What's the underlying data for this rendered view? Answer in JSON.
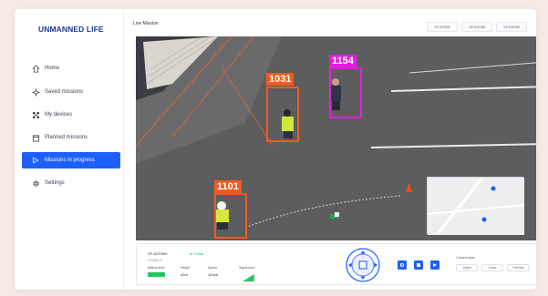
{
  "brand": "UNMANNED LIFE",
  "nav": [
    {
      "label": "Home",
      "icon": "home-icon"
    },
    {
      "label": "Saved missions",
      "icon": "sparkle-icon"
    },
    {
      "label": "My devices",
      "icon": "drone-icon"
    },
    {
      "label": "Planned missions",
      "icon": "calendar-icon"
    },
    {
      "label": "Missions in progress",
      "icon": "play-icon"
    },
    {
      "label": "Settings",
      "icon": "gear-icon"
    }
  ],
  "active_nav": "Missions in progress",
  "header": {
    "title": "Live Mission",
    "tabs": [
      "XF-ID7800",
      "XF-ID2788",
      "XF-ID3788"
    ]
  },
  "detections": [
    {
      "id": "1031",
      "color": "#f15a22"
    },
    {
      "id": "1154",
      "color": "#e51ed8"
    },
    {
      "id": "1101",
      "color": "#f15a22"
    }
  ],
  "panel": {
    "drone_id": "XF-ID07890",
    "status": "Online",
    "sub_id": "2345678",
    "stats": [
      {
        "label": "Battery level",
        "value": ""
      },
      {
        "label": "Height",
        "value": "42m"
      },
      {
        "label": "Speed",
        "value": "12m/s"
      },
      {
        "label": "Signal level",
        "value": ""
      }
    ],
    "battery_level": 0.8,
    "signal_level": 0.8,
    "camera_type_label": "Camera type",
    "camera_types": [
      "Visible",
      "Zoom",
      "Thermal"
    ]
  },
  "colors": {
    "accent": "#1d5ffb",
    "online": "#27c24c",
    "brand": "#1f3a93"
  }
}
